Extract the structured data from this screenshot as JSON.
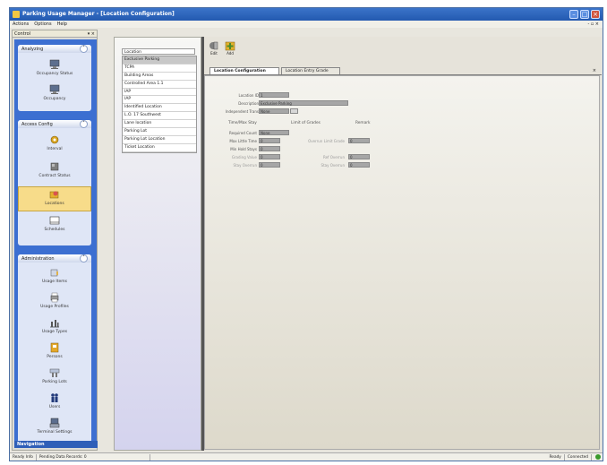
{
  "window": {
    "title": "Parking Usage Manager - [Location Configuration]",
    "menu": [
      "Actions",
      "Options",
      "Help"
    ],
    "mdi_controls": "- ▫ ×"
  },
  "navigation": {
    "header_label": "Control",
    "header_controls": "▾ ×",
    "footer": "Navigation",
    "groups": [
      {
        "title": "Analyzing",
        "items": [
          {
            "label": "Occupancy Status",
            "icon": "monitor-icon"
          },
          {
            "label": "Occupancy",
            "icon": "monitor-icon"
          }
        ]
      },
      {
        "title": "Access Config",
        "items": [
          {
            "label": "Interval",
            "icon": "gear-icon"
          },
          {
            "label": "Contract Status",
            "icon": "box-icon"
          },
          {
            "label": "Locations",
            "icon": "location-icon",
            "selected": true
          },
          {
            "label": "Schedules",
            "icon": "schedule-icon"
          }
        ]
      },
      {
        "title": "Administration",
        "items": [
          {
            "label": "Usage Items",
            "icon": "hand-icon"
          },
          {
            "label": "Usage Profiles",
            "icon": "printer-icon"
          },
          {
            "label": "Usage Types",
            "icon": "chart-icon"
          },
          {
            "label": "Persons",
            "icon": "badge-icon"
          },
          {
            "label": "Parking Lots",
            "icon": "tools-icon"
          },
          {
            "label": "Users",
            "icon": "people-icon"
          },
          {
            "label": "Terminal Settings",
            "icon": "terminal-icon"
          }
        ]
      }
    ]
  },
  "location_list": {
    "header": "Location",
    "rows": [
      "Exclusive Parking",
      "TCPA",
      "Building Areas",
      "Controlled Area 1.1",
      "IAP",
      "IAP",
      "Identified Location",
      "L.O. 17 Southwest",
      "Lane location",
      "Parking Lot",
      "Parking Lot Location",
      "Ticket Location"
    ],
    "selected_index": 0
  },
  "toolbar": {
    "buttons": [
      {
        "label": "Edit",
        "icon": "edit-icon"
      },
      {
        "label": "Add",
        "icon": "add-icon"
      }
    ]
  },
  "tabs": [
    {
      "label": "Location Configuration",
      "active": true
    },
    {
      "label": "Location Entry Grade",
      "active": false
    }
  ],
  "tab_close": "×",
  "form": {
    "location_id_label": "Location ID",
    "location_id_value": "1",
    "description_label": "Description",
    "description_value": "Exclusive Parking",
    "independent_label": "Independent Trans",
    "independent_value": "None",
    "column_headers": [
      "Time/Max Stay",
      "Limit of Grades",
      "Remark"
    ],
    "left_fields": [
      {
        "label": "Required Count",
        "value": "None"
      },
      {
        "label": "Max Little Time",
        "value": "0"
      },
      {
        "label": "Min Hold Stays",
        "value": "0"
      },
      {
        "label": "Grading Value",
        "value": "0"
      },
      {
        "label": "Stay Overrun",
        "value": "0"
      }
    ],
    "right_fields": [
      {
        "label": "Overrun Limit Grade",
        "value": "0"
      },
      {
        "label": "Ref Overrun",
        "value": "0"
      },
      {
        "label": "Stay Overrun",
        "value": "0"
      }
    ]
  },
  "statusbar": {
    "segments": [
      "Ready Info",
      "Pending Data Records: 0",
      "Ready",
      "Connected"
    ]
  }
}
